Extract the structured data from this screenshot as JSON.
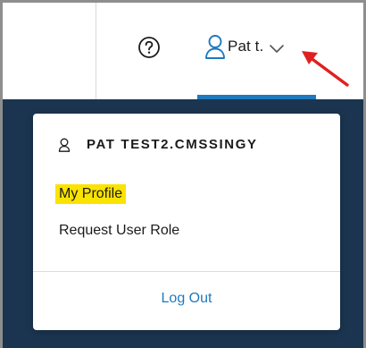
{
  "header": {
    "help_icon": "help-circle-icon",
    "user_icon": "user-outline-icon",
    "user_short_name": "Pat t.",
    "dropdown_icon": "chevron-down-icon",
    "active_underline_color": "#1e79be",
    "annotation_arrow_color": "#e02020"
  },
  "user_menu": {
    "user_icon": "user-outline-icon",
    "username": "PAT TEST2.CMSSINGY",
    "items": [
      {
        "label": "My Profile",
        "highlighted": true,
        "highlight_color": "#fbe300"
      },
      {
        "label": "Request User Role",
        "highlighted": false
      }
    ],
    "logout_label": "Log Out",
    "link_color": "#1e79be"
  },
  "background": {
    "nav_color": "#1b3550"
  }
}
